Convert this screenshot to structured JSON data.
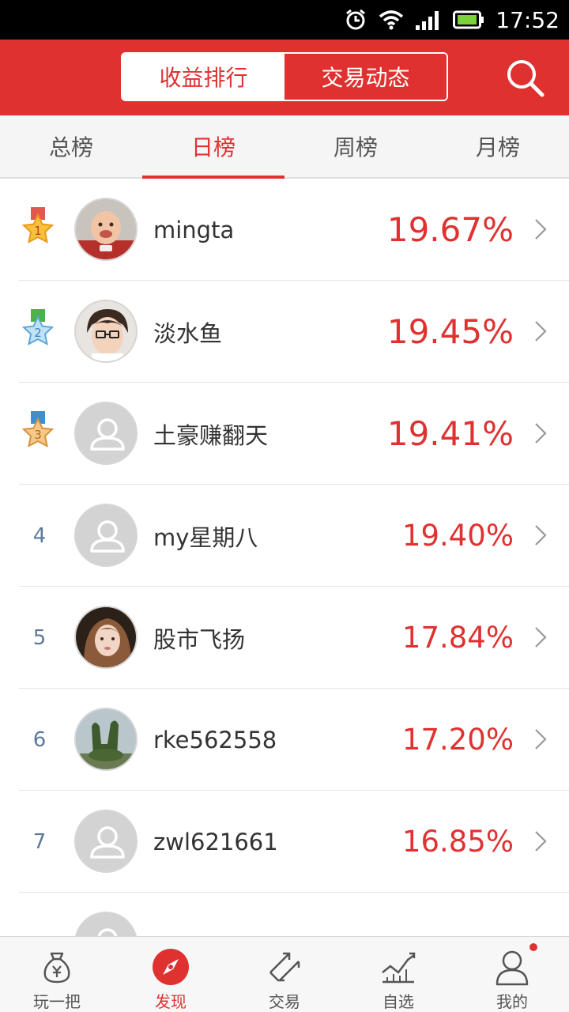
{
  "status_bar": {
    "time": "17:52"
  },
  "header": {
    "segments": [
      {
        "label": "收益排行",
        "active": true
      },
      {
        "label": "交易动态",
        "active": false
      }
    ]
  },
  "tabs": [
    {
      "label": "总榜",
      "active": false
    },
    {
      "label": "日榜",
      "active": true
    },
    {
      "label": "周榜",
      "active": false
    },
    {
      "label": "月榜",
      "active": false
    }
  ],
  "rankings": [
    {
      "rank": "1",
      "medal": "gold-medal-icon",
      "name": "mingta",
      "percent": "19.67%",
      "avatar": "baby-photo"
    },
    {
      "rank": "2",
      "medal": "silver-medal-icon",
      "name": "淡水鱼",
      "percent": "19.45%",
      "avatar": "anime-boy-photo"
    },
    {
      "rank": "3",
      "medal": "bronze-medal-icon",
      "name": "土豪赚翻天",
      "percent": "19.41%",
      "avatar": "default-avatar"
    },
    {
      "rank": "4",
      "name": "my星期八",
      "percent": "19.40%",
      "avatar": "default-avatar"
    },
    {
      "rank": "5",
      "name": "股市飞扬",
      "percent": "17.84%",
      "avatar": "girl-photo"
    },
    {
      "rank": "6",
      "name": "rke562558",
      "percent": "17.20%",
      "avatar": "topiary-photo"
    },
    {
      "rank": "7",
      "name": "zwl621661",
      "percent": "16.85%",
      "avatar": "default-avatar"
    }
  ],
  "bottom_nav": [
    {
      "label": "玩一把",
      "icon": "money-bag-icon",
      "active": false
    },
    {
      "label": "发现",
      "icon": "compass-icon",
      "active": true
    },
    {
      "label": "交易",
      "icon": "trade-arrows-icon",
      "active": false
    },
    {
      "label": "自选",
      "icon": "chart-icon",
      "active": false
    },
    {
      "label": "我的",
      "icon": "user-icon",
      "active": false,
      "badge": true
    }
  ],
  "colors": {
    "accent": "#e03131",
    "rank_number": "#5b7a9e"
  }
}
